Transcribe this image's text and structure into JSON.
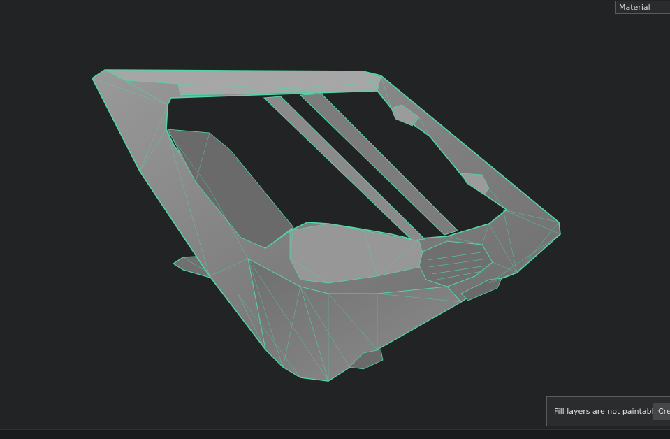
{
  "viewport": {
    "channel_select": {
      "value": "Material"
    },
    "model": {
      "name": "stand-mesh-icon",
      "wire_color": "#52d6a6",
      "surface_color": "#8c8c8c"
    }
  },
  "notification": {
    "message": "Fill layers are not paintable",
    "button_label": "Cre"
  }
}
